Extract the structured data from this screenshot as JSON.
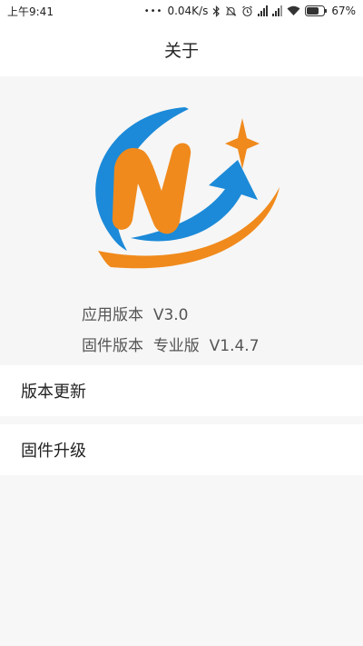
{
  "status_bar": {
    "time": "上午9:41",
    "dots": "•••",
    "net_speed": "0.04K/s",
    "battery": "67%"
  },
  "header": {
    "title": "关于"
  },
  "about": {
    "app_version_label": "应用版本",
    "app_version": "V3.0",
    "firmware_version_label": "固件版本",
    "firmware_edition": "专业版",
    "firmware_version": "V1.4.7"
  },
  "menu": {
    "items": [
      {
        "label": "版本更新"
      },
      {
        "label": "固件升级"
      }
    ]
  },
  "colors": {
    "logo_blue": "#1c8ad8",
    "logo_orange": "#f08a1c"
  }
}
